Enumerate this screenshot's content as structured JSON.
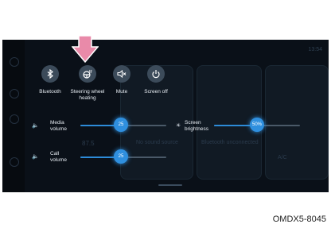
{
  "status": {
    "time": "13:54"
  },
  "quick_controls": [
    {
      "label": "Bluetooth",
      "icon": "bluetooth-icon"
    },
    {
      "label": "Steering wheel\nheating",
      "icon": "steering-wheel-heating-icon"
    },
    {
      "label": "Mute",
      "icon": "mute-icon"
    },
    {
      "label": "Screen off",
      "icon": "power-icon"
    }
  ],
  "sliders": {
    "media_volume": {
      "label": "Media\nvolume",
      "value": "25",
      "fraction": 0.45
    },
    "call_volume": {
      "label": "Call\nvolume",
      "value": "25",
      "fraction": 0.45
    },
    "screen_brightness": {
      "label": "Screen\nbrightness",
      "value": "50%",
      "fraction": 0.5
    }
  },
  "background": {
    "radio_freq": "87.5",
    "no_sound": "No sound source",
    "bt_unconnected": "Bluetooth unconnected",
    "ac": "A/C"
  },
  "caption": "OMDX5-8045",
  "colors": {
    "accent": "#2f8fde",
    "screen_bg": "#0a1018",
    "arrow": "#e98aa9"
  }
}
